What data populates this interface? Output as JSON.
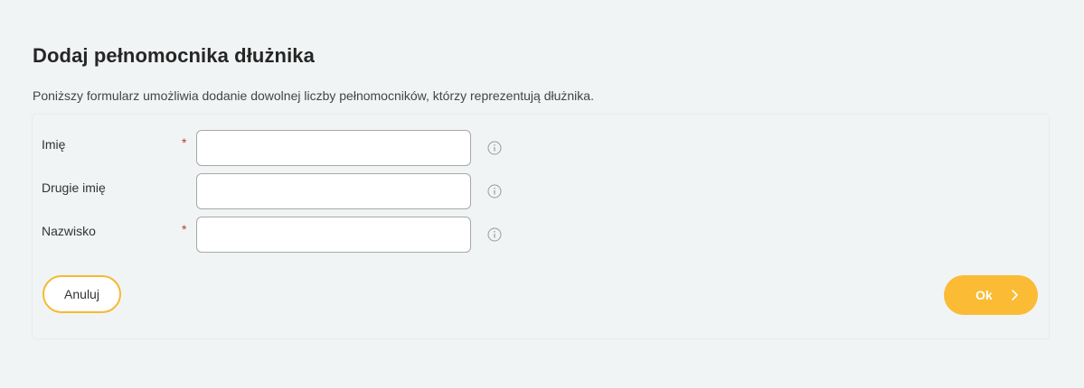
{
  "page": {
    "title": "Dodaj pełnomocnika dłużnika",
    "description": "Poniższy formularz umożliwia dodanie dowolnej liczby pełnomocników, którzy reprezentują dłużnika."
  },
  "form": {
    "fields": [
      {
        "label": "Imię",
        "required": true,
        "required_mark": "*",
        "value": "",
        "placeholder": ""
      },
      {
        "label": "Drugie imię",
        "required": false,
        "value": "",
        "placeholder": ""
      },
      {
        "label": "Nazwisko",
        "required": true,
        "required_mark": "*",
        "value": "",
        "placeholder": ""
      }
    ]
  },
  "actions": {
    "cancel_label": "Anuluj",
    "ok_label": "Ok"
  },
  "colors": {
    "background": "#f1f4f4",
    "accent": "#fbbb34",
    "accent_border": "#f6b931",
    "required": "#c0392b"
  },
  "icons": {
    "info": "info-icon",
    "ok_arrow": "chevron-right-icon"
  }
}
